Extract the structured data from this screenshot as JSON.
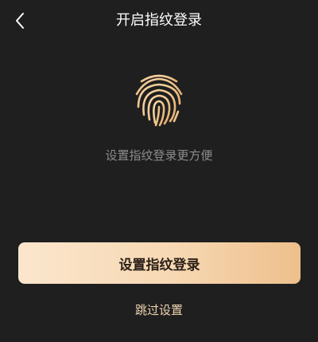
{
  "header": {
    "title": "开启指纹登录",
    "back_icon": "chevron-left-icon"
  },
  "main": {
    "fingerprint_icon": "fingerprint-icon",
    "subtitle": "设置指纹登录更方便"
  },
  "actions": {
    "primary_label": "设置指纹登录",
    "skip_label": "跳过设置"
  },
  "colors": {
    "background": "#1f1f1f",
    "accent": "#f0c98e",
    "button_gradient_start": "#fbe6cd",
    "button_gradient_end": "#eebf8c"
  }
}
